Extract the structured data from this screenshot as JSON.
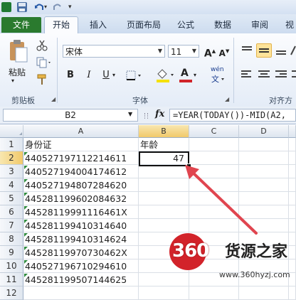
{
  "tabs": {
    "file": "文件",
    "home": "开始",
    "insert": "插入",
    "layout": "页面布局",
    "formula": "公式",
    "data": "数据",
    "review": "审阅",
    "view": "视"
  },
  "ribbon": {
    "paste_label": "粘贴",
    "font_name": "宋体",
    "font_size": "11",
    "bold": "B",
    "italic": "I",
    "underline": "U",
    "grow_font": "A",
    "shrink_font": "A",
    "wen": "wén",
    "font_color_glyph": "A",
    "groups": {
      "clipboard": "剪贴板",
      "font": "字体",
      "align": "对齐方"
    }
  },
  "formula_bar": {
    "name_box": "B2",
    "fx": "fx",
    "formula": "=YEAR(TODAY())-MID(A2,"
  },
  "columns": [
    "A",
    "B",
    "C",
    "D"
  ],
  "rows": [
    "1",
    "2",
    "3",
    "4",
    "5",
    "6",
    "7",
    "8",
    "9",
    "10",
    "11",
    "12"
  ],
  "cells": {
    "a1": "身份证",
    "b1": "年龄",
    "b2": "47",
    "ids": [
      "440527197112214611",
      "440527194004174612",
      "440527194807284620",
      "445281199602084632",
      "44528119991116461X",
      "445281199410314640",
      "445281199410314624",
      "44528119970730462X",
      "440527196710294610",
      "445281199507144625"
    ]
  },
  "watermark": {
    "logo": "360",
    "brand": "货源之家",
    "url": "www.360hyzj.com"
  },
  "colors": {
    "file_tab": "#2a7a2e",
    "arrow": "#e0454f",
    "logo": "#d2232a",
    "fill_yellow": "#f5e100",
    "font_red": "#d0242a"
  }
}
